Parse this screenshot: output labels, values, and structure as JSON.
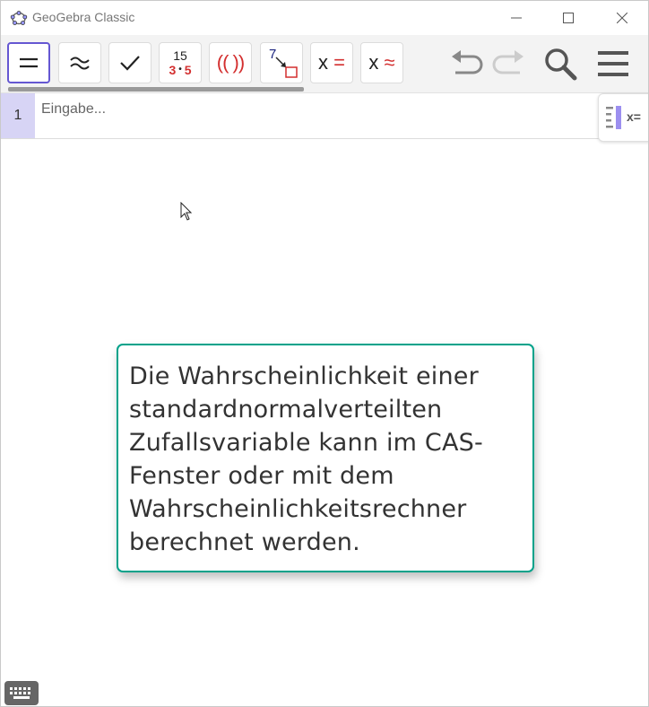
{
  "window": {
    "title": "GeoGebra Classic",
    "icon": "geogebra-logo-icon",
    "controls": [
      "minimize-icon",
      "maximize-icon",
      "close-icon"
    ]
  },
  "toolbar": {
    "tools": [
      {
        "id": "evaluate",
        "icon": "equals-icon",
        "active": true
      },
      {
        "id": "numeric",
        "icon": "approx-icon",
        "active": false
      },
      {
        "id": "keep-input",
        "icon": "checkmark-icon",
        "active": false
      },
      {
        "id": "factor",
        "icon": "factor-icon",
        "top": "15",
        "bottom_left": "3",
        "dot": "•",
        "bottom_right": "5",
        "active": false
      },
      {
        "id": "expand",
        "icon": "expand-icon",
        "label": "(( ))",
        "active": false
      },
      {
        "id": "substitute",
        "icon": "substitute-icon",
        "label": "7",
        "active": false
      },
      {
        "id": "solve",
        "icon": "solve-icon",
        "x": "x",
        "sign": "=",
        "active": false
      },
      {
        "id": "solve-numeric",
        "icon": "solve-numeric-icon",
        "x": "x",
        "sign": "≈",
        "active": false
      }
    ],
    "right": [
      "undo-icon",
      "redo-icon",
      "search-icon",
      "menu-icon"
    ]
  },
  "cas": {
    "row_number": "1",
    "placeholder": "Eingabe...",
    "value": ""
  },
  "algebra_toggle": {
    "icon": "algebra-view-icon",
    "label": "x="
  },
  "tooltip": {
    "text": "Die Wahrscheinlichkeit einer standardnormalverteilten Zufallsvariable kann im CAS-Fenster oder mit dem Wahrscheinlichkeitsrechner berechnet werden."
  },
  "keyboard": {
    "icon": "keyboard-icon"
  },
  "colors": {
    "accent": "#6557d2",
    "row_bg": "#d7d4f5",
    "tooltip_border": "#00a28a",
    "red": "#d32f2f"
  }
}
